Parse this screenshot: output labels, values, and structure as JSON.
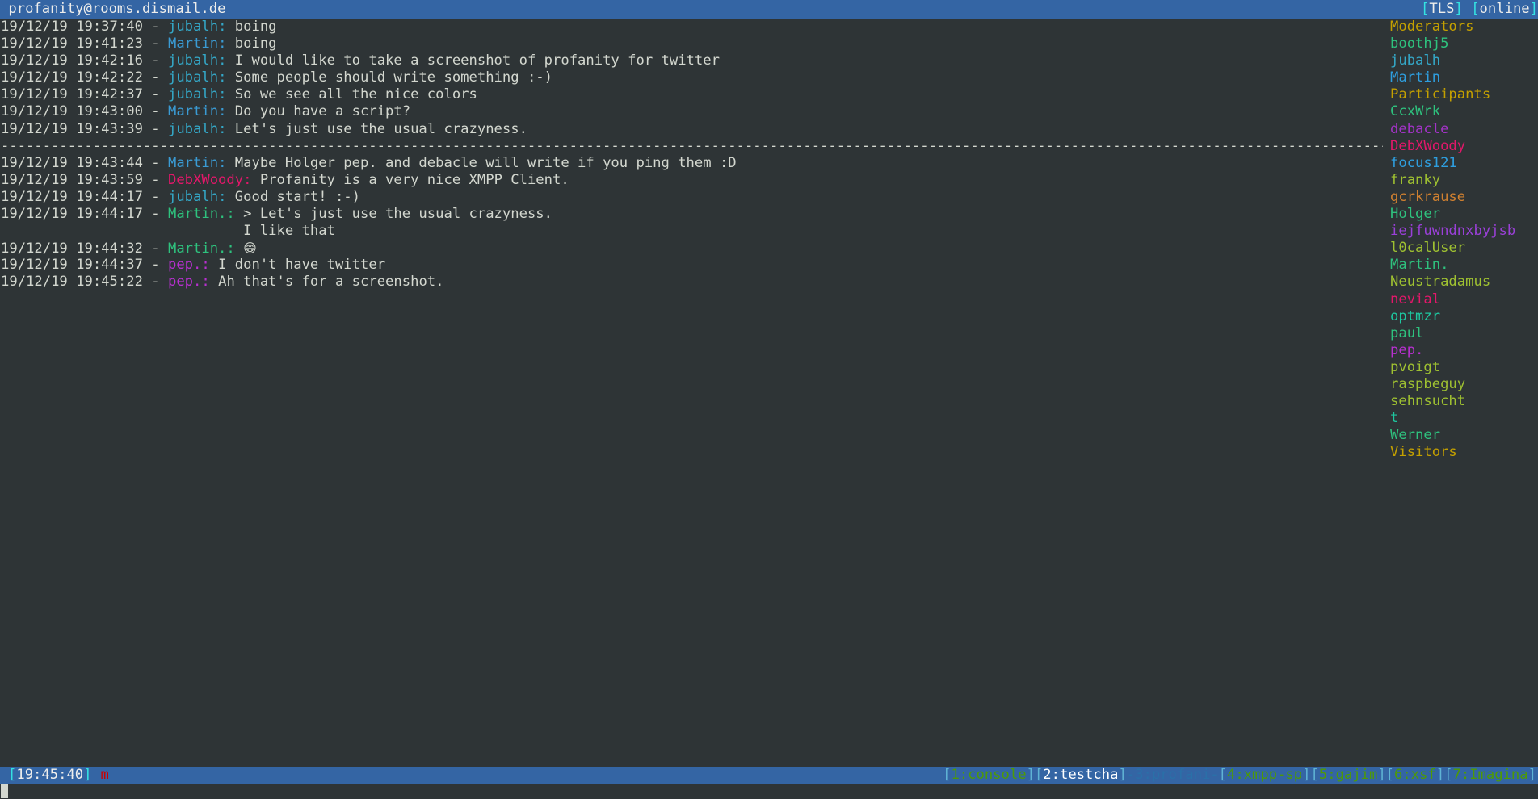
{
  "titlebar": {
    "account": "profanity@rooms.dismail.de",
    "tls_label": "TLS",
    "status_label": "online",
    "bracket_open": "[",
    "bracket_close": "]"
  },
  "chat": {
    "lines": [
      {
        "type": "message",
        "timestamp": "19/12/19 19:37:40",
        "sep": " - ",
        "nick": "jubalh",
        "nick_color": "c-cyan",
        "text": "boing"
      },
      {
        "type": "message",
        "timestamp": "19/12/19 19:41:23",
        "sep": " - ",
        "nick": "Martin",
        "nick_color": "c-blue",
        "text": "boing"
      },
      {
        "type": "message",
        "timestamp": "19/12/19 19:42:16",
        "sep": " - ",
        "nick": "jubalh",
        "nick_color": "c-cyan",
        "text": "I would like to take a screenshot of profanity for twitter"
      },
      {
        "type": "message",
        "timestamp": "19/12/19 19:42:22",
        "sep": " - ",
        "nick": "jubalh",
        "nick_color": "c-cyan",
        "text": "Some people should write something :-)"
      },
      {
        "type": "message",
        "timestamp": "19/12/19 19:42:37",
        "sep": " - ",
        "nick": "jubalh",
        "nick_color": "c-cyan",
        "text": "So we see all the nice colors"
      },
      {
        "type": "message",
        "timestamp": "19/12/19 19:43:00",
        "sep": " - ",
        "nick": "Martin",
        "nick_color": "c-blue",
        "text": "Do you have a script?"
      },
      {
        "type": "message",
        "timestamp": "19/12/19 19:43:39",
        "sep": " - ",
        "nick": "jubalh",
        "nick_color": "c-cyan",
        "text": "Let's just use the usual crazyness."
      },
      {
        "type": "separator",
        "text": "------------------------------------------------------------------------------------------------------------------------------------------------------------------------"
      },
      {
        "type": "message",
        "timestamp": "19/12/19 19:43:44",
        "sep": " - ",
        "nick": "Martin",
        "nick_color": "c-blue",
        "text": "Maybe Holger pep. and debacle will write if you ping them :D"
      },
      {
        "type": "message",
        "timestamp": "19/12/19 19:43:59",
        "sep": " - ",
        "nick": "DebXWoody",
        "nick_color": "c-pink",
        "text": "Profanity is a very nice XMPP Client."
      },
      {
        "type": "message",
        "timestamp": "19/12/19 19:44:17",
        "sep": " - ",
        "nick": "jubalh",
        "nick_color": "c-cyan",
        "text": "Good start! :-)"
      },
      {
        "type": "message",
        "timestamp": "19/12/19 19:44:17",
        "sep": " - ",
        "nick": "Martin.",
        "nick_color": "c-green",
        "text": "> Let's just use the usual crazyness."
      },
      {
        "type": "continuation",
        "indent": "                             ",
        "text": "I like that"
      },
      {
        "type": "message",
        "timestamp": "19/12/19 19:44:32",
        "sep": " - ",
        "nick": "Martin.",
        "nick_color": "c-green",
        "text": "",
        "emoji": "😁"
      },
      {
        "type": "message",
        "timestamp": "19/12/19 19:44:37",
        "sep": " - ",
        "nick": "pep.",
        "nick_color": "c-magenta",
        "text": "I don't have twitter"
      },
      {
        "type": "message",
        "timestamp": "19/12/19 19:45:22",
        "sep": " - ",
        "nick": "pep.",
        "nick_color": "c-magenta",
        "text": "Ah that's for a screenshot."
      }
    ]
  },
  "roster": {
    "entries": [
      {
        "label": "Moderators",
        "role": "header",
        "color": "r-header"
      },
      {
        "label": "boothj5",
        "role": "moderator",
        "color": "c-green"
      },
      {
        "label": "jubalh",
        "role": "moderator",
        "color": "c-cyan"
      },
      {
        "label": "Martin",
        "role": "moderator",
        "color": "c-skyblue"
      },
      {
        "label": "Participants",
        "role": "header",
        "color": "r-header"
      },
      {
        "label": "CcxWrk",
        "role": "participant",
        "color": "c-green"
      },
      {
        "label": "debacle",
        "role": "participant",
        "color": "c-purple"
      },
      {
        "label": "DebXWoody",
        "role": "participant",
        "color": "c-crimson"
      },
      {
        "label": "focus121",
        "role": "participant",
        "color": "c-skyblue"
      },
      {
        "label": "franky",
        "role": "participant",
        "color": "c-lime"
      },
      {
        "label": "gcrkrause",
        "role": "participant",
        "color": "c-orange"
      },
      {
        "label": "Holger",
        "role": "participant",
        "color": "c-green"
      },
      {
        "label": "iejfuwndnxbyjsb",
        "role": "participant",
        "color": "c-violet"
      },
      {
        "label": "l0calUser",
        "role": "participant",
        "color": "c-lime"
      },
      {
        "label": "Martin.",
        "role": "participant",
        "color": "c-green"
      },
      {
        "label": "Neustradamus",
        "role": "participant",
        "color": "c-lime"
      },
      {
        "label": "nevial",
        "role": "participant",
        "color": "c-crimson"
      },
      {
        "label": "optmzr",
        "role": "participant",
        "color": "c-teal"
      },
      {
        "label": "paul",
        "role": "participant",
        "color": "c-green"
      },
      {
        "label": "pep.",
        "role": "participant",
        "color": "c-magenta"
      },
      {
        "label": "pvoigt",
        "role": "participant",
        "color": "c-lime"
      },
      {
        "label": "raspbeguy",
        "role": "participant",
        "color": "c-lime"
      },
      {
        "label": "sehnsucht",
        "role": "participant",
        "color": "c-lime"
      },
      {
        "label": "t",
        "role": "participant",
        "color": "c-teal"
      },
      {
        "label": "Werner",
        "role": "participant",
        "color": "c-green"
      },
      {
        "label": "Visitors",
        "role": "header",
        "color": "r-header"
      }
    ]
  },
  "statusbar": {
    "clock": "19:45:40",
    "bracket_open": "[",
    "bracket_close": "]",
    "input_mode": "m",
    "windows": [
      {
        "label": "1:console",
        "state": "inactive",
        "open": "[",
        "close": "]"
      },
      {
        "label": "2:testcha",
        "state": "active",
        "open": "[",
        "close": "]"
      },
      {
        "label": "3:profani",
        "state": "dim",
        "open": "-",
        "close": "-"
      },
      {
        "label": "4:xmpp-sp",
        "state": "inactive",
        "open": "[",
        "close": "]"
      },
      {
        "label": "5:gajim",
        "state": "inactive",
        "open": "[",
        "close": "]"
      },
      {
        "label": "6:xsf",
        "state": "inactive",
        "open": "[",
        "close": "]"
      },
      {
        "label": "7:Imagina",
        "state": "inactive",
        "open": "[",
        "close": "]"
      }
    ]
  },
  "input": {
    "value": "",
    "cursor_visible": true
  }
}
